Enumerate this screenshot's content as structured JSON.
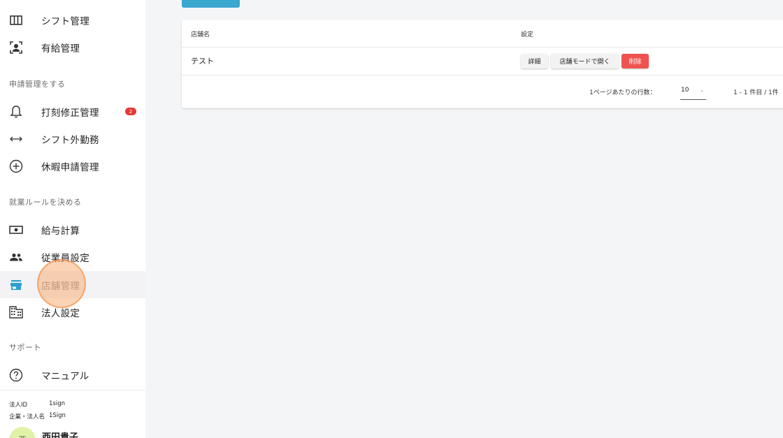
{
  "sidebar": {
    "items": [
      {
        "label": "シフト管理",
        "icon": "columns-icon"
      },
      {
        "label": "有給管理",
        "icon": "person-frame-icon"
      },
      {
        "label": "打刻修正管理",
        "icon": "bell-icon",
        "badge": "2"
      },
      {
        "label": "シフト外勤務",
        "icon": "arrows-horizontal-icon"
      },
      {
        "label": "休暇申請管理",
        "icon": "add-circle-icon"
      },
      {
        "label": "給与計算",
        "icon": "money-icon"
      },
      {
        "label": "従業員設定",
        "icon": "people-icon"
      },
      {
        "label": "店舗管理",
        "icon": "store-icon",
        "active": true
      },
      {
        "label": "法人設定",
        "icon": "building-icon"
      },
      {
        "label": "マニュアル",
        "icon": "help-circle-icon"
      }
    ],
    "sections": {
      "requests": "申請管理をする",
      "rules": "就業ルールを決める",
      "support": "サポート"
    },
    "corp_info": {
      "id_label": "法人ID",
      "id_value": "1sign",
      "name_label": "企業・法人名",
      "name_value": "1Sign"
    },
    "user": {
      "avatar_text": "西",
      "name": "西田貴子"
    }
  },
  "table": {
    "headers": {
      "store_name": "店舗名",
      "settings": "設定"
    },
    "rows": [
      {
        "store_name": "テスト"
      }
    ],
    "actions": {
      "detail": "詳細",
      "open_store_mode": "店舗モードで開く",
      "delete": "削除"
    },
    "pagination": {
      "rows_per_page_label": "1ページあたりの行数：",
      "rows_per_page_value": "10",
      "range": "1 - 1 件目 / 1件"
    }
  },
  "colors": {
    "accent": "#3aa7cf",
    "danger": "#ef5350",
    "badge": "#e53935",
    "active_icon": "#2b9fd0"
  }
}
